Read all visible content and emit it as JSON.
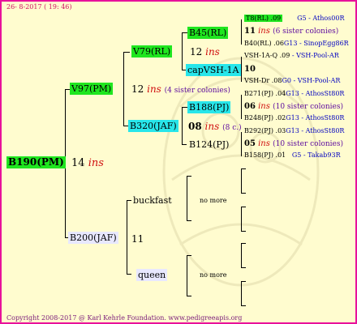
{
  "header": "26- 8-2017 ( 19: 46)",
  "footer": "Copyright 2008-2017 @ Karl Kehrle Foundation.   www.pedigreeapis.org",
  "colors": {
    "border": "#e8119b",
    "bg": "#fffccf",
    "green": "#1fe61f",
    "cyan": "#28e6ea",
    "lavender": "#e8e8ff",
    "ins": "#d01010",
    "link": "#0000c0"
  },
  "root": {
    "label": "B190(PM)",
    "num": "14",
    "ins": "ins"
  },
  "gen1": [
    {
      "label": "V97(PM)",
      "num": "12",
      "ins": "ins",
      "sister": "(4 sister colonies)"
    },
    {
      "label": "B200(JAF)",
      "num": "11"
    }
  ],
  "gen2": [
    {
      "label": "V79(RL)",
      "num": "12",
      "ins": "ins"
    },
    {
      "label": "B320(JAF)",
      "num": "08",
      "ins": "ins",
      "sister": "(8 c.)"
    },
    {
      "label": "buckfast",
      "nomore": "no more"
    },
    {
      "label": "queen",
      "nomore": "no more"
    }
  ],
  "gen3": [
    {
      "label": "B45(RL)"
    },
    {
      "label": "capVSH-1A",
      "num": "10"
    },
    {
      "label": "B188(PJ)"
    },
    {
      "label": "B124(PJ)"
    }
  ],
  "gen4": [
    {
      "a": "T8(RL) .09",
      "b": "G5 - Athos00R"
    },
    {
      "a": "11",
      "ins": "ins",
      "c": "(6 sister colonies)"
    },
    {
      "a": "B40(RL) .06",
      "b": "G13 - SinopEgg86R"
    },
    {
      "a": "VSH-1A-Q .09",
      "b": "- VSH-Pool-AR"
    },
    {
      "a": "10"
    },
    {
      "a": "VSH-Dr .08",
      "b": "G0 - VSH-Pool-AR"
    },
    {
      "a": "B271(PJ) .04",
      "b": "G13 - AthosSt80R"
    },
    {
      "a": "06",
      "ins": "ins",
      "c": "(10 sister colonies)"
    },
    {
      "a": "B248(PJ) .02",
      "b": "G13 - AthosSt80R"
    },
    {
      "a": "B292(PJ) .03",
      "b": "G13 - AthosSt80R"
    },
    {
      "a": "05",
      "ins": "ins",
      "c": "(10 sister colonies)"
    },
    {
      "a": "B158(PJ) .01",
      "b": "G5 - Takab93R"
    }
  ]
}
